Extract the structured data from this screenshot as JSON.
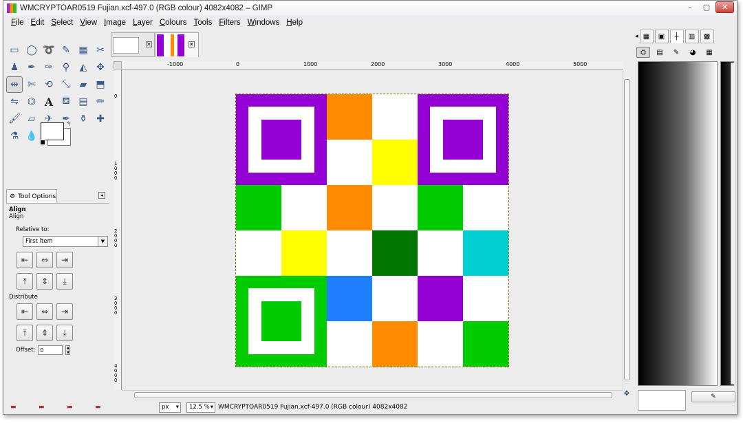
{
  "window": {
    "title": "WMCRYPTOAR0519 Fujian.xcf-497.0 (RGB colour) 4082x4082 – GIMP",
    "min_glyph": "–",
    "max_glyph": "▢",
    "close_glyph": "✕"
  },
  "menu": [
    "File",
    "Edit",
    "Select",
    "View",
    "Image",
    "Layer",
    "Colours",
    "Tools",
    "Filters",
    "Windows",
    "Help"
  ],
  "toolbox": {
    "tools": [
      {
        "icon": "rect-select-icon",
        "glyph": "▭"
      },
      {
        "icon": "ellipse-select-icon",
        "glyph": "◯"
      },
      {
        "icon": "free-select-icon",
        "glyph": "➰"
      },
      {
        "icon": "fuzzy-select-icon",
        "glyph": "✎"
      },
      {
        "icon": "select-by-color-icon",
        "glyph": "▦"
      },
      {
        "icon": "scissors-icon",
        "glyph": "✂"
      },
      {
        "icon": "foreground-select-icon",
        "glyph": "♟"
      },
      {
        "icon": "paths-icon",
        "glyph": "✒"
      },
      {
        "icon": "color-picker-icon",
        "glyph": "✑"
      },
      {
        "icon": "zoom-icon",
        "glyph": "⚲"
      },
      {
        "icon": "measure-icon",
        "glyph": "◭"
      },
      {
        "icon": "move-icon",
        "glyph": "✥"
      },
      {
        "icon": "align-icon",
        "glyph": "⇹"
      },
      {
        "icon": "crop-icon",
        "glyph": "✄"
      },
      {
        "icon": "rotate-icon",
        "glyph": "⟲"
      },
      {
        "icon": "scale-icon",
        "glyph": "⤡"
      },
      {
        "icon": "shear-icon",
        "glyph": "▰"
      },
      {
        "icon": "perspective-icon",
        "glyph": "⬒"
      },
      {
        "icon": "flip-icon",
        "glyph": "⇋"
      },
      {
        "icon": "cage-icon",
        "glyph": "⌬"
      },
      {
        "icon": "text-icon",
        "glyph": "A"
      },
      {
        "icon": "bucket-fill-icon",
        "glyph": "⛾"
      },
      {
        "icon": "blend-icon",
        "glyph": "▤"
      },
      {
        "icon": "pencil-icon",
        "glyph": "✏"
      },
      {
        "icon": "paintbrush-icon",
        "glyph": "🖌"
      },
      {
        "icon": "eraser-icon",
        "glyph": "▱"
      },
      {
        "icon": "airbrush-icon",
        "glyph": "✈"
      },
      {
        "icon": "ink-icon",
        "glyph": "✒"
      },
      {
        "icon": "clone-icon",
        "glyph": "⚱"
      },
      {
        "icon": "heal-icon",
        "glyph": "✚"
      },
      {
        "icon": "perspective-clone-icon",
        "glyph": "⚗"
      },
      {
        "icon": "blur-icon",
        "glyph": "💧"
      },
      {
        "icon": "smudge-icon",
        "glyph": "☝"
      },
      {
        "icon": "dodge-burn-icon",
        "glyph": "⚫"
      }
    ],
    "active_index": 12
  },
  "tool_options": {
    "tab_label": "Tool Options",
    "heading": "Align",
    "subheading": "Align",
    "relative_to_label": "Relative to:",
    "relative_to_value": "First item",
    "align_buttons": [
      [
        "align-left-edge-icon",
        "⇤"
      ],
      [
        "align-center-h-icon",
        "⇔"
      ],
      [
        "align-right-edge-icon",
        "⇥"
      ],
      [
        "align-top-edge-icon",
        "⤒"
      ],
      [
        "align-middle-v-icon",
        "⇕"
      ],
      [
        "align-bottom-edge-icon",
        "⤓"
      ]
    ],
    "distribute_label": "Distribute",
    "distribute_buttons": [
      [
        "distribute-left-icon",
        "⇤"
      ],
      [
        "distribute-center-h-icon",
        "⇔"
      ],
      [
        "distribute-right-icon",
        "⇥"
      ],
      [
        "distribute-top-icon",
        "⤒"
      ],
      [
        "distribute-middle-v-icon",
        "⇕"
      ],
      [
        "distribute-bottom-icon",
        "⤓"
      ]
    ],
    "offset_label": "Offset:",
    "offset_value": "0"
  },
  "rulers": {
    "h_labels": [
      "-1000",
      "0",
      "1000",
      "2000",
      "3000",
      "4000",
      "5000"
    ],
    "v_labels": [
      "0",
      "1000",
      "2000",
      "3000",
      "4000"
    ]
  },
  "image": {
    "colors": {
      "purple": "#9400d3",
      "orange": "#ff8c00",
      "yellow": "#ffff00",
      "green": "#00cc00",
      "dark_green": "#007700",
      "cyan": "#00ced1",
      "blue": "#1e7fff",
      "white": "#ffffff"
    },
    "grid": [
      [
        "purple-finder",
        null,
        "orange",
        "white",
        "purple-finder",
        null
      ],
      [
        null,
        null,
        "white",
        "yellow",
        null,
        null
      ],
      [
        "green",
        "white",
        "orange",
        "white",
        "green",
        "white"
      ],
      [
        "white",
        "yellow",
        "white",
        "dark_green",
        "white",
        "cyan"
      ],
      [
        "green-finder",
        null,
        "blue",
        "white",
        "purple",
        "white"
      ],
      [
        null,
        null,
        "white",
        "orange",
        "white",
        "green"
      ]
    ]
  },
  "statusbar": {
    "unit": "px",
    "zoom": "12.5 %",
    "text": "WMCRYPTOAR0519 Fujian.xcf-497.0 (RGB colour) 4082x4082"
  },
  "dock": {
    "button_label": ""
  }
}
